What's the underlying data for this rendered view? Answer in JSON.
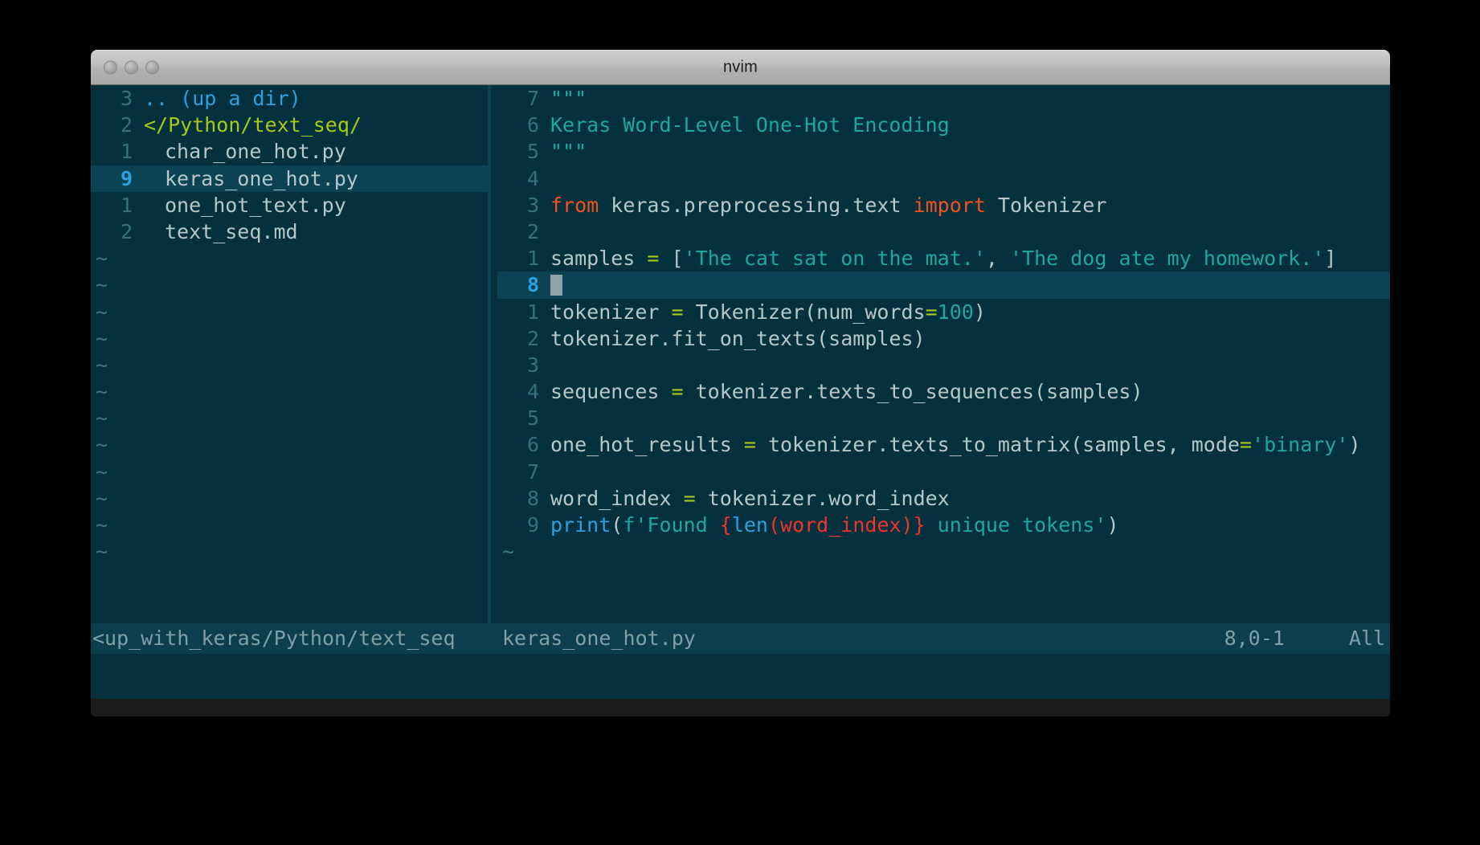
{
  "window": {
    "title": "nvim",
    "traffic_lights": [
      "close-button",
      "minimize-button",
      "zoom-button"
    ]
  },
  "file_tree": {
    "rows": [
      {
        "num": "3",
        "indent": 0,
        "text": ".. (up a dir)",
        "kind": "updir",
        "selected": false
      },
      {
        "num": "2",
        "indent": 0,
        "text": "</Python/text_seq/",
        "kind": "dir",
        "selected": false
      },
      {
        "num": "1",
        "indent": 1,
        "text": "char_one_hot.py",
        "kind": "file",
        "selected": false
      },
      {
        "num": "9",
        "indent": 1,
        "text": "keras_one_hot.py",
        "kind": "file",
        "selected": true
      },
      {
        "num": "1",
        "indent": 1,
        "text": "one_hot_text.py",
        "kind": "file",
        "selected": false
      },
      {
        "num": "2",
        "indent": 1,
        "text": "text_seq.md",
        "kind": "file",
        "selected": false
      }
    ],
    "empty_marker": "~",
    "empty_rows": 12
  },
  "editor": {
    "lines": [
      {
        "num": "7",
        "cursor_line": false,
        "tokens": [
          {
            "t": "\"\"\"",
            "c": "s-com"
          }
        ]
      },
      {
        "num": "6",
        "cursor_line": false,
        "tokens": [
          {
            "t": "Keras Word-Level One-Hot Encoding",
            "c": "s-com"
          }
        ]
      },
      {
        "num": "5",
        "cursor_line": false,
        "tokens": [
          {
            "t": "\"\"\"",
            "c": "s-com"
          }
        ]
      },
      {
        "num": "4",
        "cursor_line": false,
        "tokens": []
      },
      {
        "num": "3",
        "cursor_line": false,
        "tokens": [
          {
            "t": "from",
            "c": "s-kw"
          },
          {
            "t": " keras.preprocessing.text ",
            "c": "s-plain"
          },
          {
            "t": "import",
            "c": "s-kw"
          },
          {
            "t": " Tokenizer",
            "c": "s-plain"
          }
        ]
      },
      {
        "num": "2",
        "cursor_line": false,
        "tokens": []
      },
      {
        "num": "1",
        "cursor_line": false,
        "tokens": [
          {
            "t": "samples ",
            "c": "s-plain"
          },
          {
            "t": "=",
            "c": "s-op"
          },
          {
            "t": " [",
            "c": "s-plain"
          },
          {
            "t": "'The cat sat on the mat.'",
            "c": "s-str"
          },
          {
            "t": ", ",
            "c": "s-plain"
          },
          {
            "t": "'The dog ate my homework.'",
            "c": "s-str"
          },
          {
            "t": "]",
            "c": "s-plain"
          }
        ]
      },
      {
        "num": "8",
        "cursor_line": true,
        "tokens": []
      },
      {
        "num": "1",
        "cursor_line": false,
        "tokens": [
          {
            "t": "tokenizer ",
            "c": "s-plain"
          },
          {
            "t": "=",
            "c": "s-op"
          },
          {
            "t": " Tokenizer(num_words",
            "c": "s-plain"
          },
          {
            "t": "=",
            "c": "s-op"
          },
          {
            "t": "100",
            "c": "s-num"
          },
          {
            "t": ")",
            "c": "s-plain"
          }
        ]
      },
      {
        "num": "2",
        "cursor_line": false,
        "tokens": [
          {
            "t": "tokenizer.fit_on_texts(samples)",
            "c": "s-plain"
          }
        ]
      },
      {
        "num": "3",
        "cursor_line": false,
        "tokens": []
      },
      {
        "num": "4",
        "cursor_line": false,
        "tokens": [
          {
            "t": "sequences ",
            "c": "s-plain"
          },
          {
            "t": "=",
            "c": "s-op"
          },
          {
            "t": " tokenizer.texts_to_sequences(samples)",
            "c": "s-plain"
          }
        ]
      },
      {
        "num": "5",
        "cursor_line": false,
        "tokens": []
      },
      {
        "num": "6",
        "cursor_line": false,
        "tokens": [
          {
            "t": "one_hot_results ",
            "c": "s-plain"
          },
          {
            "t": "=",
            "c": "s-op"
          },
          {
            "t": " tokenizer.texts_to_matrix(samples, mode",
            "c": "s-plain"
          },
          {
            "t": "=",
            "c": "s-op"
          },
          {
            "t": "'binary'",
            "c": "s-str"
          },
          {
            "t": ")",
            "c": "s-plain"
          }
        ]
      },
      {
        "num": "7",
        "cursor_line": false,
        "tokens": []
      },
      {
        "num": "8",
        "cursor_line": false,
        "tokens": [
          {
            "t": "word_index ",
            "c": "s-plain"
          },
          {
            "t": "=",
            "c": "s-op"
          },
          {
            "t": " tokenizer.word_index",
            "c": "s-plain"
          }
        ]
      },
      {
        "num": "9",
        "cursor_line": false,
        "tokens": [
          {
            "t": "print",
            "c": "s-fn"
          },
          {
            "t": "(",
            "c": "s-plain"
          },
          {
            "t": "f'Found ",
            "c": "s-com"
          },
          {
            "t": "{",
            "c": "s-red"
          },
          {
            "t": "len",
            "c": "s-fn"
          },
          {
            "t": "(",
            "c": "s-red"
          },
          {
            "t": "word_index",
            "c": "s-red"
          },
          {
            "t": ")",
            "c": "s-red"
          },
          {
            "t": "}",
            "c": "s-red"
          },
          {
            "t": " unique tokens'",
            "c": "s-com"
          },
          {
            "t": ")",
            "c": "s-plain"
          }
        ]
      }
    ],
    "empty_marker": "~"
  },
  "status": {
    "tree_path": "<up_with_keras/Python/text_seq",
    "file_name": "keras_one_hot.py",
    "position": "8,0-1",
    "scroll": "All"
  },
  "colors": {
    "background": "#04313d",
    "cursor_line": "#0b4354",
    "statusline": "#0c3f4d",
    "accent_blue": "#2f9fe0",
    "dir_green": "#a8c81a",
    "string_teal": "#1ea6a0",
    "keyword_orange": "#f4511e",
    "red": "#f0332b",
    "plain_text": "#b6c7c9",
    "line_number": "#35717d"
  }
}
